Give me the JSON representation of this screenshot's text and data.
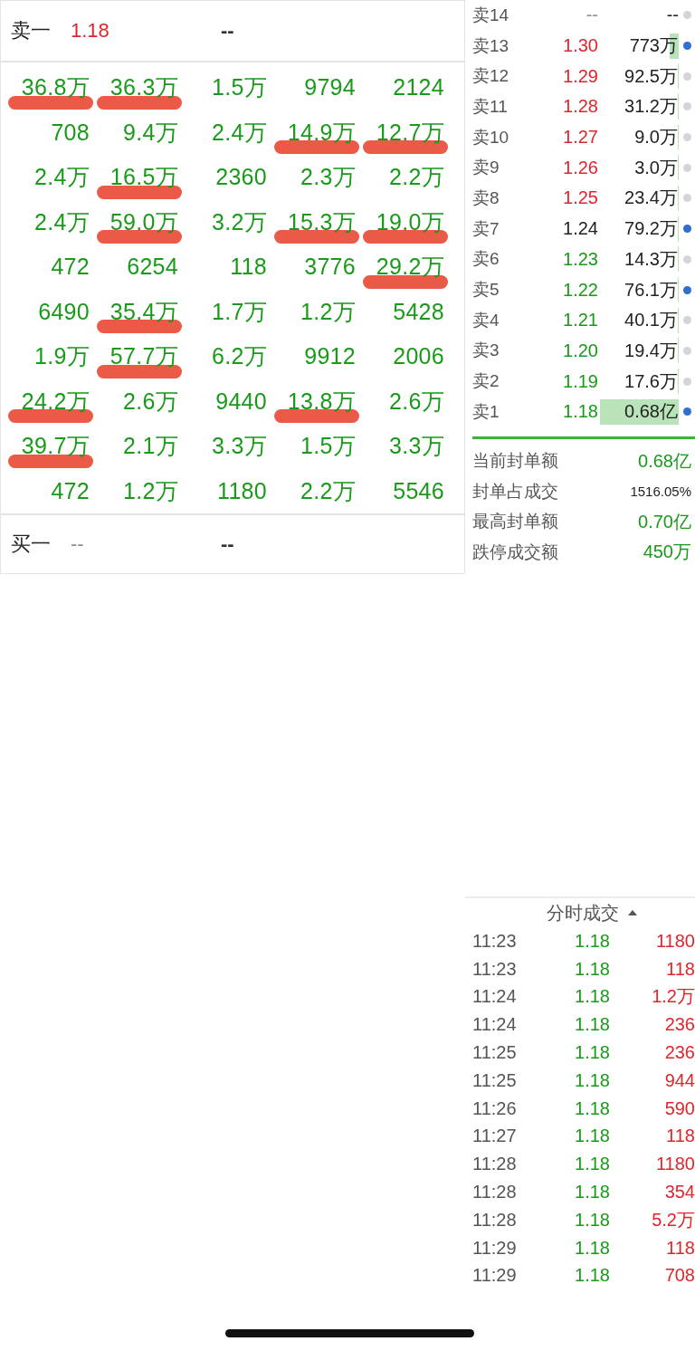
{
  "ask_header": {
    "label": "卖一",
    "price": {
      "text": "1.18",
      "color": "#e0262d"
    },
    "value": "--"
  },
  "order_queue": {
    "rows": [
      [
        {
          "text": "36.8万",
          "marked": true
        },
        {
          "text": "36.3万",
          "marked": true
        },
        {
          "text": "1.5万",
          "marked": false
        },
        {
          "text": "9794",
          "marked": false
        },
        {
          "text": "2124",
          "marked": false
        }
      ],
      [
        {
          "text": "708",
          "marked": false
        },
        {
          "text": "9.4万",
          "marked": false
        },
        {
          "text": "2.4万",
          "marked": false
        },
        {
          "text": "14.9万",
          "marked": true
        },
        {
          "text": "12.7万",
          "marked": true
        }
      ],
      [
        {
          "text": "2.4万",
          "marked": false
        },
        {
          "text": "16.5万",
          "marked": true
        },
        {
          "text": "2360",
          "marked": false
        },
        {
          "text": "2.3万",
          "marked": false
        },
        {
          "text": "2.2万",
          "marked": false
        }
      ],
      [
        {
          "text": "2.4万",
          "marked": false
        },
        {
          "text": "59.0万",
          "marked": true
        },
        {
          "text": "3.2万",
          "marked": false
        },
        {
          "text": "15.3万",
          "marked": true
        },
        {
          "text": "19.0万",
          "marked": true
        }
      ],
      [
        {
          "text": "472",
          "marked": false
        },
        {
          "text": "6254",
          "marked": false
        },
        {
          "text": "118",
          "marked": false
        },
        {
          "text": "3776",
          "marked": false
        },
        {
          "text": "29.2万",
          "marked": true
        }
      ],
      [
        {
          "text": "6490",
          "marked": false
        },
        {
          "text": "35.4万",
          "marked": true
        },
        {
          "text": "1.7万",
          "marked": false
        },
        {
          "text": "1.2万",
          "marked": false
        },
        {
          "text": "5428",
          "marked": false
        }
      ],
      [
        {
          "text": "1.9万",
          "marked": false
        },
        {
          "text": "57.7万",
          "marked": true
        },
        {
          "text": "6.2万",
          "marked": false
        },
        {
          "text": "9912",
          "marked": false
        },
        {
          "text": "2006",
          "marked": false
        }
      ],
      [
        {
          "text": "24.2万",
          "marked": true
        },
        {
          "text": "2.6万",
          "marked": false
        },
        {
          "text": "9440",
          "marked": false
        },
        {
          "text": "13.8万",
          "marked": true
        },
        {
          "text": "2.6万",
          "marked": false
        }
      ],
      [
        {
          "text": "39.7万",
          "marked": true
        },
        {
          "text": "2.1万",
          "marked": false
        },
        {
          "text": "3.3万",
          "marked": false
        },
        {
          "text": "1.5万",
          "marked": false
        },
        {
          "text": "3.3万",
          "marked": false
        }
      ],
      [
        {
          "text": "472",
          "marked": false
        },
        {
          "text": "1.2万",
          "marked": false
        },
        {
          "text": "1180",
          "marked": false
        },
        {
          "text": "2.2万",
          "marked": false
        },
        {
          "text": "5546",
          "marked": false
        }
      ]
    ]
  },
  "bid_header": {
    "label": "买一",
    "price": {
      "text": "--",
      "color": "#8e8e93"
    },
    "value": "--"
  },
  "sell_levels": [
    {
      "label": "卖14",
      "price": {
        "text": "--",
        "color": "#8e8e93"
      },
      "quantity": "--",
      "dot": {
        "color": "#d3d5db"
      }
    },
    {
      "label": "卖13",
      "price": {
        "text": "1.30",
        "color": "#e0262d"
      },
      "quantity": "773万",
      "level": 0.11,
      "dot": {
        "color": "#2f6fd0"
      }
    },
    {
      "label": "卖12",
      "price": {
        "text": "1.29",
        "color": "#e0262d"
      },
      "quantity": "92.5万",
      "dot": {
        "color": "#d3d5db"
      }
    },
    {
      "label": "卖11",
      "price": {
        "text": "1.28",
        "color": "#e0262d"
      },
      "quantity": "31.2万",
      "dot": {
        "color": "#d3d5db"
      }
    },
    {
      "label": "卖10",
      "price": {
        "text": "1.27",
        "color": "#e0262d"
      },
      "quantity": "9.0万",
      "dot": {
        "color": "#d3d5db"
      }
    },
    {
      "label": "卖9",
      "price": {
        "text": "1.26",
        "color": "#e0262d"
      },
      "quantity": "3.0万",
      "dot": {
        "color": "#d3d5db"
      }
    },
    {
      "label": "卖8",
      "price": {
        "text": "1.25",
        "color": "#e0262d"
      },
      "quantity": "23.4万",
      "dot": {
        "color": "#d3d5db"
      }
    },
    {
      "label": "卖7",
      "price": {
        "text": "1.24",
        "color": "#1f1f1f"
      },
      "quantity": "79.2万",
      "dot": {
        "color": "#2f6fd0"
      }
    },
    {
      "label": "卖6",
      "price": {
        "text": "1.23",
        "color": "#1a9a1a"
      },
      "quantity": "14.3万",
      "dot": {
        "color": "#d3d5db"
      }
    },
    {
      "label": "卖5",
      "price": {
        "text": "1.22",
        "color": "#1a9a1a"
      },
      "quantity": "76.1万",
      "dot": {
        "color": "#2f6fd0"
      }
    },
    {
      "label": "卖4",
      "price": {
        "text": "1.21",
        "color": "#1a9a1a"
      },
      "quantity": "40.1万",
      "dot": {
        "color": "#d3d5db"
      }
    },
    {
      "label": "卖3",
      "price": {
        "text": "1.20",
        "color": "#1a9a1a"
      },
      "quantity": "19.4万",
      "dot": {
        "color": "#d3d5db"
      }
    },
    {
      "label": "卖2",
      "price": {
        "text": "1.19",
        "color": "#1a9a1a"
      },
      "quantity": "17.6万",
      "dot": {
        "color": "#d3d5db"
      }
    },
    {
      "label": "卖1",
      "price": {
        "text": "1.18",
        "color": "#1a9a1a"
      },
      "quantity": "0.68亿",
      "level": 1,
      "dot": {
        "color": "#2f6fd0"
      }
    }
  ],
  "seal_stats": [
    {
      "label": "当前封单额",
      "value": "0.68亿",
      "kind": "amount"
    },
    {
      "label": "封单占成交",
      "value": "1516.05%",
      "kind": "ratio"
    },
    {
      "label": "最高封单额",
      "value": "0.70亿",
      "kind": "amount"
    },
    {
      "label": "跌停成交额",
      "value": "450万",
      "kind": "amount"
    }
  ],
  "trades": {
    "title": "分时成交",
    "rows": [
      {
        "time": "11:23",
        "price": "1.18",
        "volume": "1180"
      },
      {
        "time": "11:23",
        "price": "1.18",
        "volume": "118"
      },
      {
        "time": "11:24",
        "price": "1.18",
        "volume": "1.2万"
      },
      {
        "time": "11:24",
        "price": "1.18",
        "volume": "236"
      },
      {
        "time": "11:25",
        "price": "1.18",
        "volume": "236"
      },
      {
        "time": "11:25",
        "price": "1.18",
        "volume": "944"
      },
      {
        "time": "11:26",
        "price": "1.18",
        "volume": "590"
      },
      {
        "time": "11:27",
        "price": "1.18",
        "volume": "118"
      },
      {
        "time": "11:28",
        "price": "1.18",
        "volume": "1180"
      },
      {
        "time": "11:28",
        "price": "1.18",
        "volume": "354"
      },
      {
        "time": "11:28",
        "price": "1.18",
        "volume": "5.2万"
      },
      {
        "time": "11:29",
        "price": "1.18",
        "volume": "118"
      },
      {
        "time": "11:29",
        "price": "1.18",
        "volume": "708"
      }
    ]
  }
}
